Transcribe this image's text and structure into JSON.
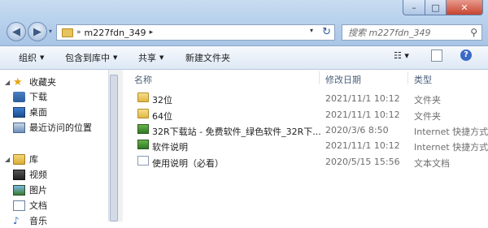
{
  "window": {
    "minimize_label": "–",
    "maximize_label": "□",
    "close_label": "✕"
  },
  "nav_buttons": {
    "back_glyph": "◀",
    "forward_glyph": "▶",
    "dropdown_glyph": "▾"
  },
  "address": {
    "separator": "»",
    "path": "m227fdn_349",
    "arrow": "▸",
    "dropdown_glyph": "▾",
    "refresh_glyph": "↻"
  },
  "search": {
    "placeholder": "搜索 m227fdn_349",
    "icon_glyph": "⚲"
  },
  "toolbar": {
    "organize": "组织",
    "include_library": "包含到库中",
    "share": "共享",
    "new_folder": "新建文件夹",
    "caret": "▼",
    "views_glyph": "☷ ▾",
    "help_glyph": "?"
  },
  "nav": {
    "favorites": {
      "label": "收藏夹",
      "items": [
        {
          "label": "下载",
          "icon": "download-folder-icon"
        },
        {
          "label": "桌面",
          "icon": "desktop-icon"
        },
        {
          "label": "最近访问的位置",
          "icon": "recent-places-icon"
        }
      ]
    },
    "libraries": {
      "label": "库",
      "items": [
        {
          "label": "视频",
          "icon": "videos-library-icon"
        },
        {
          "label": "图片",
          "icon": "pictures-library-icon"
        },
        {
          "label": "文档",
          "icon": "documents-library-icon"
        },
        {
          "label": "音乐",
          "icon": "music-library-icon"
        }
      ]
    },
    "expand_glyph": "◢",
    "star_glyph": "★",
    "note_glyph": "♪"
  },
  "columns": {
    "name": "名称",
    "modified": "修改日期",
    "type": "类型"
  },
  "files": [
    {
      "name": "32位",
      "modified": "2021/11/1 10:12",
      "type": "文件夹",
      "kind": "folder"
    },
    {
      "name": "64位",
      "modified": "2021/11/1 10:12",
      "type": "文件夹",
      "kind": "folder"
    },
    {
      "name": "32R下载站 - 免费软件_绿色软件_32R下...",
      "modified": "2020/3/6 8:50",
      "type": "Internet 快捷方式",
      "kind": "shortcut"
    },
    {
      "name": "软件说明",
      "modified": "2021/11/1 10:12",
      "type": "Internet 快捷方式",
      "kind": "shortcut"
    },
    {
      "name": "使用说明（必看）",
      "modified": "2020/5/15 15:56",
      "type": "文本文档",
      "kind": "text"
    }
  ]
}
